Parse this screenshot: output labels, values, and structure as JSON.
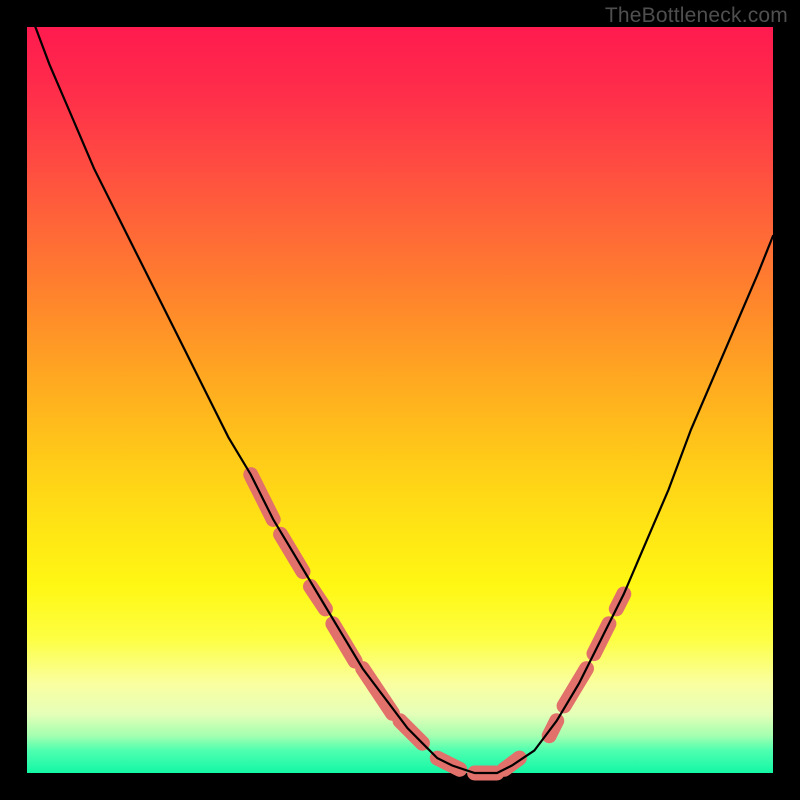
{
  "watermark": "TheBottleneck.com",
  "chart_data": {
    "type": "line",
    "title": "",
    "xlabel": "",
    "ylabel": "",
    "xlim": [
      0,
      100
    ],
    "ylim": [
      0,
      100
    ],
    "series": [
      {
        "name": "curve",
        "x": [
          0,
          3,
          6,
          9,
          12,
          15,
          18,
          21,
          24,
          27,
          30,
          33,
          36,
          39,
          42,
          45,
          48,
          51,
          53,
          55,
          57,
          60,
          63,
          65,
          68,
          71,
          74,
          77,
          80,
          83,
          86,
          89,
          92,
          95,
          98,
          100
        ],
        "y": [
          103,
          95,
          88,
          81,
          75,
          69,
          63,
          57,
          51,
          45,
          40,
          34,
          29,
          24,
          19,
          14,
          10,
          6,
          4,
          2,
          1,
          0,
          0,
          1,
          3,
          7,
          12,
          18,
          24,
          31,
          38,
          46,
          53,
          60,
          67,
          72
        ]
      }
    ],
    "highlight_segments": [
      {
        "x1": 30,
        "y1": 40,
        "x2": 33,
        "y2": 34
      },
      {
        "x1": 34,
        "y1": 32,
        "x2": 37,
        "y2": 27
      },
      {
        "x1": 38,
        "y1": 25,
        "x2": 40,
        "y2": 22
      },
      {
        "x1": 41,
        "y1": 20,
        "x2": 44,
        "y2": 15
      },
      {
        "x1": 45,
        "y1": 14,
        "x2": 49,
        "y2": 8
      },
      {
        "x1": 50,
        "y1": 7,
        "x2": 53,
        "y2": 4
      },
      {
        "x1": 55,
        "y1": 2,
        "x2": 58,
        "y2": 0.5
      },
      {
        "x1": 60,
        "y1": 0,
        "x2": 63,
        "y2": 0
      },
      {
        "x1": 64,
        "y1": 0.5,
        "x2": 66,
        "y2": 2
      },
      {
        "x1": 70,
        "y1": 5,
        "x2": 71,
        "y2": 7
      },
      {
        "x1": 72,
        "y1": 9,
        "x2": 75,
        "y2": 14
      },
      {
        "x1": 76,
        "y1": 16,
        "x2": 78,
        "y2": 20
      },
      {
        "x1": 79,
        "y1": 22,
        "x2": 80,
        "y2": 24
      }
    ],
    "colors": {
      "curve": "#000000",
      "highlight": "#e2706b",
      "gradient_top": "#ff1a4f",
      "gradient_bottom": "#13f7a5"
    }
  }
}
